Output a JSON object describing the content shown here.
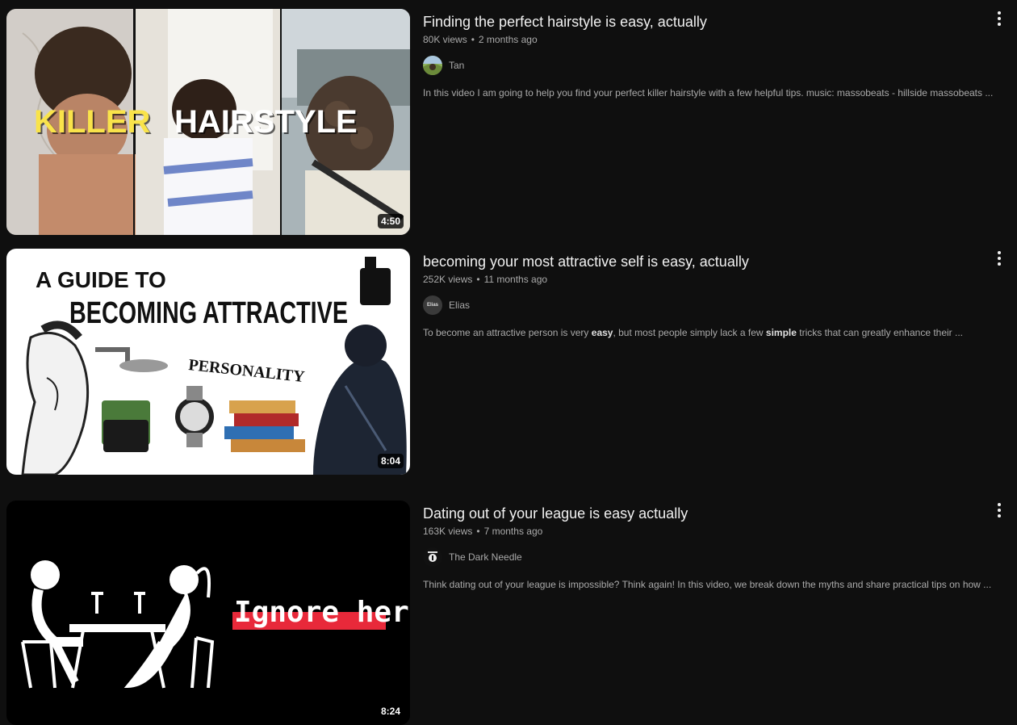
{
  "results": [
    {
      "title": "Finding the perfect hairstyle is easy, actually",
      "views": "80K views",
      "age": "2 months ago",
      "channel": "Tan",
      "description": "In this video I am going to help you find your perfect killer hairstyle with a few helpful tips. music: massobeats - hillside massobeats ...",
      "duration": "4:50",
      "thumb_text": [
        "KILLER",
        "HAIRSTYLE"
      ]
    },
    {
      "title": "becoming your most attractive self is easy, actually",
      "views": "252K views",
      "age": "11 months ago",
      "channel": "Elias",
      "avatar_text": "Elias",
      "description_parts": [
        "To become an attractive person is very ",
        "easy",
        ", but most people simply lack a few ",
        "simple",
        " tricks that can greatly enhance their ..."
      ],
      "duration": "8:04",
      "thumb_text": [
        "A GUIDE TO",
        "BECOMING ATTRACTIVE",
        "PERSONALITY"
      ]
    },
    {
      "title": "Dating out of your league is easy actually",
      "views": "163K views",
      "age": "7 months ago",
      "channel": "The Dark Needle",
      "description": "Think dating out of your league is impossible? Think again! In this video, we break down the myths and share practical tips on how ...",
      "duration": "8:24",
      "thumb_text": [
        "Ignore her"
      ]
    }
  ],
  "meta_separator": "•",
  "icons": {
    "more": "more-vert-icon"
  },
  "colors": {
    "background": "#0f0f0f",
    "text": "#f1f1f1",
    "secondary": "#aaaaaa",
    "highlight": "#e8293a"
  }
}
